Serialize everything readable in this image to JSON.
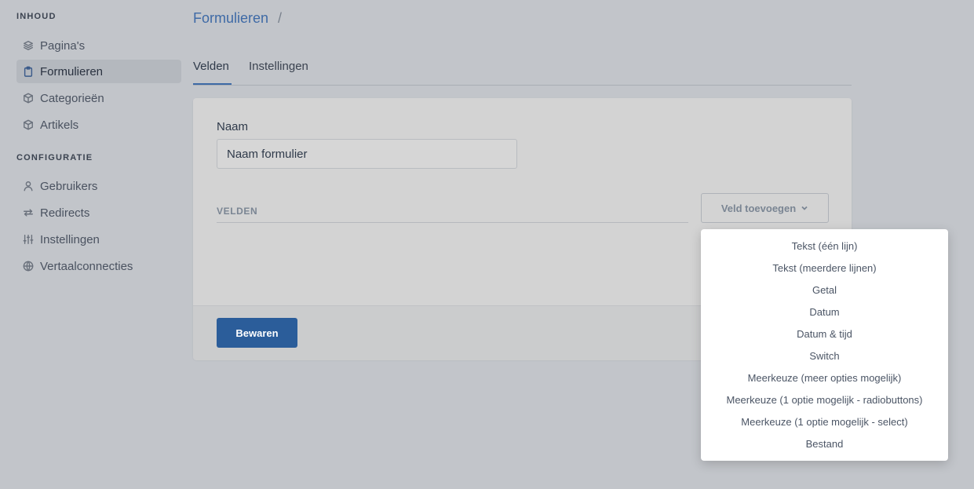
{
  "sidebar": {
    "sections": [
      {
        "title": "INHOUD",
        "items": [
          {
            "label": "Pagina's",
            "icon": "layers-icon"
          },
          {
            "label": "Formulieren",
            "icon": "clipboard-icon",
            "active": true
          },
          {
            "label": "Categorieën",
            "icon": "cube-icon"
          },
          {
            "label": "Artikels",
            "icon": "cube-icon"
          }
        ]
      },
      {
        "title": "CONFIGURATIE",
        "items": [
          {
            "label": "Gebruikers",
            "icon": "user-icon"
          },
          {
            "label": "Redirects",
            "icon": "arrows-icon"
          },
          {
            "label": "Instellingen",
            "icon": "sliders-icon"
          },
          {
            "label": "Vertaalconnecties",
            "icon": "globe-icon"
          }
        ]
      }
    ]
  },
  "breadcrumb": {
    "current": "Formulieren",
    "separator": "/"
  },
  "tabs": [
    {
      "label": "Velden",
      "active": true
    },
    {
      "label": "Instellingen"
    }
  ],
  "form": {
    "name_label": "Naam",
    "name_value": "Naam formulier",
    "fields_heading": "VELDEN",
    "add_field_label": "Veld toevoegen",
    "save_label": "Bewaren"
  },
  "dropdown": {
    "items": [
      "Tekst (één lijn)",
      "Tekst (meerdere lijnen)",
      "Getal",
      "Datum",
      "Datum & tijd",
      "Switch",
      "Meerkeuze (meer opties mogelijk)",
      "Meerkeuze (1 optie mogelijk - radiobuttons)",
      "Meerkeuze (1 optie mogelijk - select)",
      "Bestand"
    ]
  },
  "colors": {
    "accent": "#3e6aa6",
    "primary_button": "#2b5d9a",
    "background": "#c2c5ca"
  }
}
